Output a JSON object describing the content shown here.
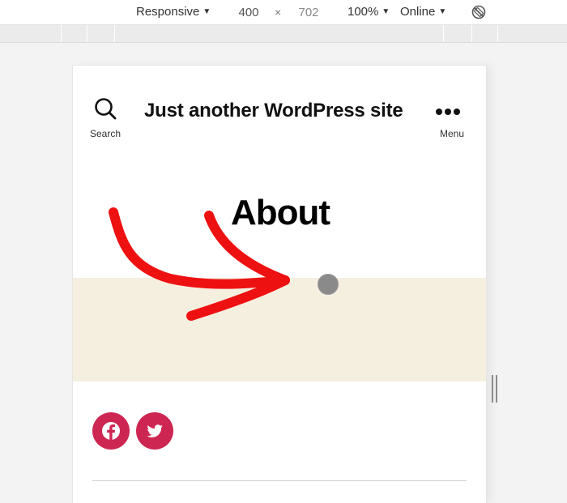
{
  "devtools": {
    "device_mode": "Responsive",
    "width_value": "400",
    "height_value": "702",
    "times_symbol": "×",
    "zoom": "100%",
    "network": "Online",
    "caret": "▼"
  },
  "site": {
    "header": {
      "search_label": "Search",
      "description": "Just another WordPress site",
      "menu_label": "Menu"
    },
    "page_title": "About",
    "featured_color": "#f5efe0",
    "social": [
      {
        "name": "facebook",
        "icon": "facebook-icon"
      },
      {
        "name": "twitter",
        "icon": "twitter-icon"
      }
    ],
    "accent_color": "#cd2653"
  },
  "annotation": {
    "arrow_color": "#ee1111",
    "cursor_color": "#8a8a8a"
  }
}
